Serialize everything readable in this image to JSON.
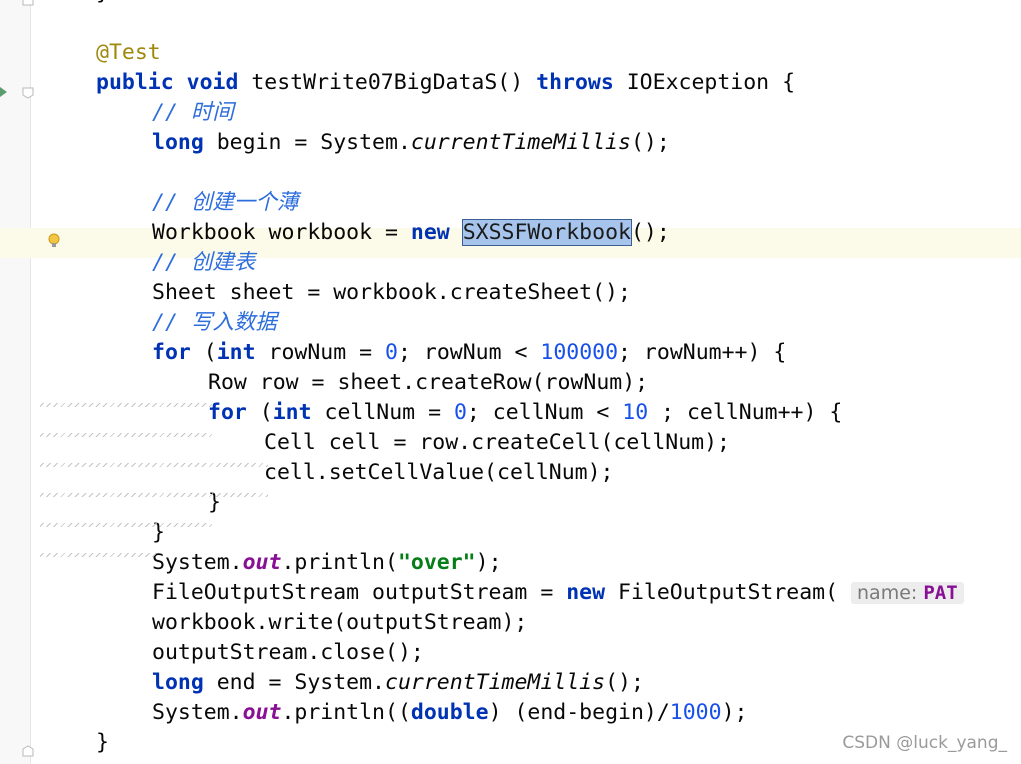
{
  "watermark": "CSDN @luck_yang_",
  "code": {
    "l0": "}",
    "l2_ann": "@Test",
    "l3_kw1": "public",
    "l3_kw2": "void",
    "l3_name": " testWrite07BigDataS() ",
    "l3_kw3": "throws",
    "l3_rest": " IOException {",
    "l4_comment": "// 时间",
    "l5_kw": "long",
    "l5_a": " begin = System.",
    "l5_it": "currentTimeMillis",
    "l5_b": "();",
    "l7_comment": "// 创建一个薄",
    "l8_a": "Workbook workbook = ",
    "l8_kw": "new",
    "l8_sel": "SXSSFWorkbook",
    "l8_b": "();",
    "l9_comment": "// 创建表",
    "l10": "Sheet sheet = workbook.createSheet();",
    "l11_comment": "// 写入数据",
    "l12_kw1": "for",
    "l12_a": " (",
    "l12_kw2": "int",
    "l12_b": " rowNum = ",
    "l12_n1": "0",
    "l12_c": "; rowNum < ",
    "l12_n2": "100000",
    "l12_d": "; rowNum++) {",
    "l13": "Row row = sheet.createRow(rowNum);",
    "l14_kw1": "for",
    "l14_a": " (",
    "l14_kw2": "int",
    "l14_b": " cellNum = ",
    "l14_n1": "0",
    "l14_c": "; cellNum < ",
    "l14_n2": "10",
    "l14_d": " ; cellNum++) {",
    "l15": "Cell cell = row.createCell(cellNum);",
    "l16": "cell.setCellValue(cellNum);",
    "l17": "}",
    "l18": "}",
    "l19_a": "System.",
    "l19_st": "out",
    "l19_b": ".println(",
    "l19_str": "\"over\"",
    "l19_c": ");",
    "l20_a": "FileOutputStream outputStream = ",
    "l20_kw": "new",
    "l20_b": " FileOutputStream(",
    "l20_hint_label": "name:",
    "l20_hint_val": "PAT",
    "l21": "workbook.write(outputStream);",
    "l22": "outputStream.close();",
    "l23_kw": "long",
    "l23_a": " end = System.",
    "l23_it": "currentTimeMillis",
    "l23_b": "();",
    "l24_a": "System.",
    "l24_st": "out",
    "l24_b": ".println((",
    "l24_kw": "double",
    "l24_c": ") (end-begin)/",
    "l24_n": "1000",
    "l24_d": ");",
    "l25": "}"
  }
}
